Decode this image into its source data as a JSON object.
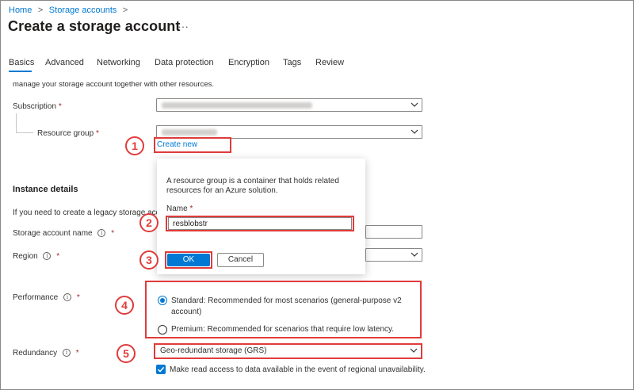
{
  "breadcrumb": {
    "home": "Home",
    "storage_accounts": "Storage accounts"
  },
  "page": {
    "title": "Create a storage account",
    "more": "···"
  },
  "tabs": [
    {
      "label": "Basics",
      "active": true
    },
    {
      "label": "Advanced"
    },
    {
      "label": "Networking"
    },
    {
      "label": "Data protection"
    },
    {
      "label": "Encryption"
    },
    {
      "label": "Tags"
    },
    {
      "label": "Review"
    }
  ],
  "intro_text": "manage your storage account together with other resources.",
  "form": {
    "subscription_label": "Subscription",
    "resource_group_label": "Resource group",
    "create_new_link": "Create new",
    "instance_details_heading": "Instance details",
    "legacy_text": "If you need to create a legacy storage acco",
    "storage_account_name_label": "Storage account name",
    "region_label": "Region",
    "performance_label": "Performance",
    "performance_options": [
      {
        "label": "Standard: Recommended for most scenarios (general-purpose v2 account)",
        "selected": true
      },
      {
        "label": "Premium: Recommended for scenarios that require low latency.",
        "selected": false
      }
    ],
    "redundancy_label": "Redundancy",
    "redundancy_value": "Geo-redundant storage (GRS)",
    "read_access_label": "Make read access to data available in the event of regional unavailability.",
    "read_access_checked": true,
    "required_mark": "*",
    "info_glyph": "i"
  },
  "popup": {
    "description": "A resource group is a container that holds related resources for an Azure solution.",
    "name_label": "Name",
    "name_value": "resblobstr",
    "ok_label": "OK",
    "cancel_label": "Cancel"
  },
  "callout_numbers": [
    "1",
    "2",
    "3",
    "4",
    "5"
  ],
  "colors": {
    "accent": "#0078d4",
    "callout_red": "#e03b3b",
    "required_red": "#a4262c"
  }
}
